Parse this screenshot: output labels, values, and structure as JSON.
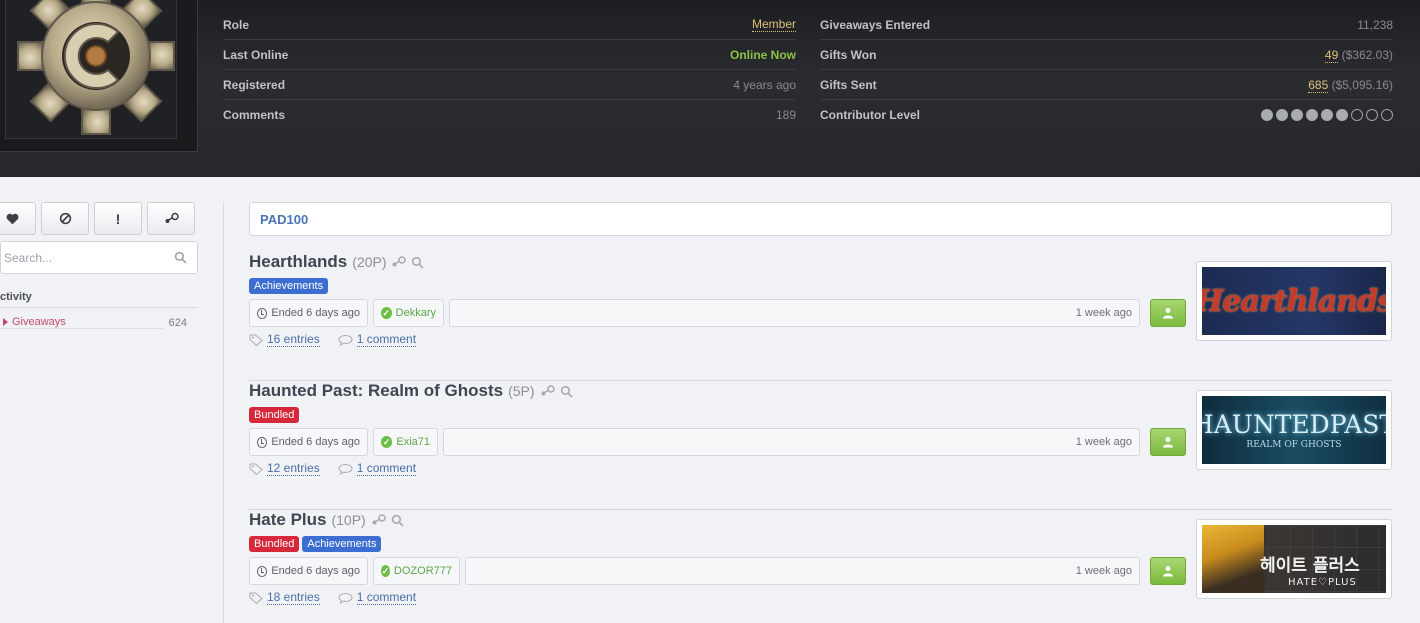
{
  "profile": {
    "stats_left": [
      {
        "label": "Role",
        "value": "Member"
      },
      {
        "label": "Last Online",
        "value": "Online Now"
      },
      {
        "label": "Registered",
        "value": "4 years ago"
      },
      {
        "label": "Comments",
        "value": "189"
      }
    ],
    "stats_right": {
      "entered_label": "Giveaways Entered",
      "entered_value": "11,238",
      "won_label": "Gifts Won",
      "won_count": "49",
      "won_value": "($362.03)",
      "sent_label": "Gifts Sent",
      "sent_count": "685",
      "sent_value": "($5,095.16)",
      "level_label": "Contributor Level",
      "level_filled": 6,
      "level_total": 9
    }
  },
  "sidebar": {
    "buttons": [
      {
        "icon": "heart-icon"
      },
      {
        "icon": "block-icon"
      },
      {
        "icon": "exclamation-icon"
      },
      {
        "icon": "steam-icon"
      }
    ],
    "search_placeholder": "Search...",
    "heading": "ctivity",
    "items": [
      {
        "label": "Giveaways",
        "count": "624"
      }
    ]
  },
  "main": {
    "heading": "PAD100",
    "giveaways": [
      {
        "name": "Hearthlands",
        "points": "(20P)",
        "tags": [
          {
            "label": "Achievements",
            "color": "#3b6ed0"
          }
        ],
        "ended": "Ended 6 days ago",
        "winner": "Dekkary",
        "created": "1 week ago",
        "entries": "16 entries",
        "comments": "1 comment",
        "image_text": "Hearthlands"
      },
      {
        "name": "Haunted Past: Realm of Ghosts",
        "points": "(5P)",
        "tags": [
          {
            "label": "Bundled",
            "color": "#d6283a"
          }
        ],
        "ended": "Ended 6 days ago",
        "winner": "Exia71",
        "created": "1 week ago",
        "entries": "12 entries",
        "comments": "1 comment",
        "image_text": "HAUNTEDPAST",
        "image_subtext": "REALM OF GHOSTS"
      },
      {
        "name": "Hate Plus",
        "points": "(10P)",
        "tags": [
          {
            "label": "Bundled",
            "color": "#d6283a"
          },
          {
            "label": "Achievements",
            "color": "#3b6ed0"
          }
        ],
        "ended": "Ended 6 days ago",
        "winner": "DOZOR777",
        "created": "1 week ago",
        "entries": "18 entries",
        "comments": "1 comment",
        "image_text": "헤이트 플러스",
        "image_subtext": "HATE♡PLUS"
      }
    ]
  },
  "colors": {
    "accent_blue": "#4b73b5",
    "winner_green": "#5aa64a",
    "gold": "#d9c07a",
    "online_green": "#8bc34a"
  }
}
